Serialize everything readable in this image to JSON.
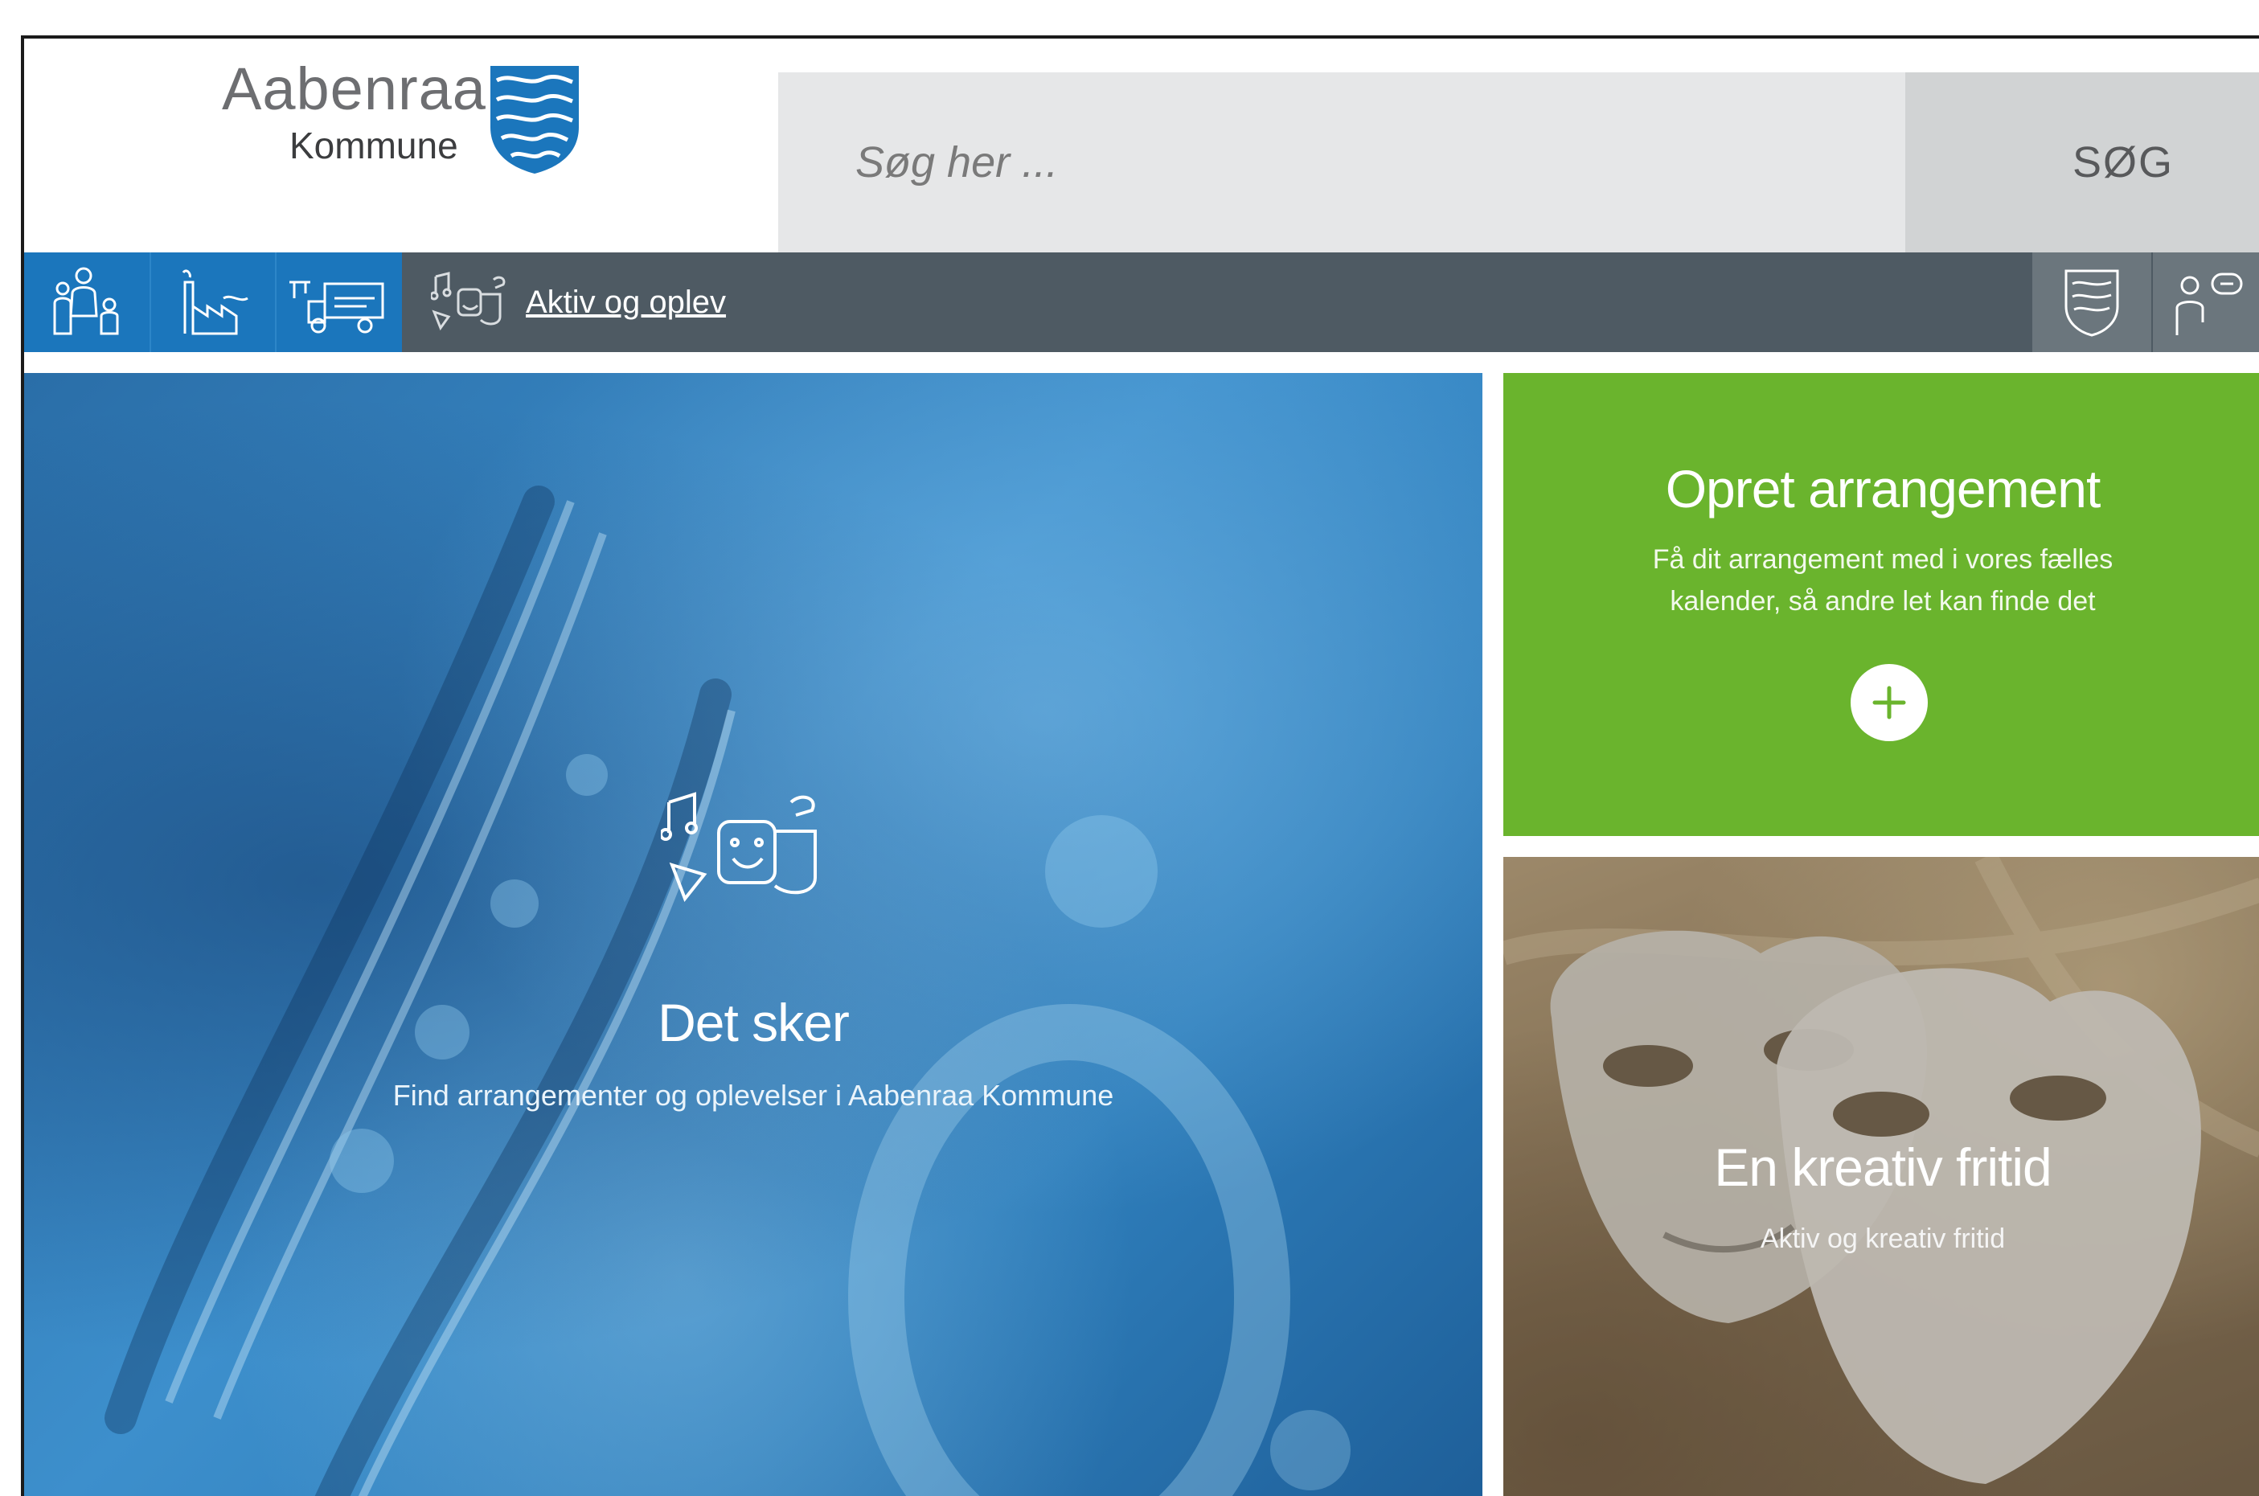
{
  "header": {
    "logo_line1": "Aabenraa",
    "logo_line2": "Kommune"
  },
  "search": {
    "placeholder": "Søg her ...",
    "button_label": "SØG"
  },
  "nav": {
    "items": [
      {
        "icon": "family-icon"
      },
      {
        "icon": "factory-icon"
      },
      {
        "icon": "tools-truck-icon"
      },
      {
        "icon": "culture-masks-icon",
        "label": "Aktiv og oplev",
        "active": true
      }
    ],
    "right_items": [
      {
        "icon": "municipality-shield-icon"
      },
      {
        "icon": "person-chat-icon"
      }
    ]
  },
  "tiles": {
    "hero": {
      "title": "Det sker",
      "subtitle": "Find arrangementer og oplevelser i Aabenraa Kommune"
    },
    "create": {
      "title": "Opret arrangement",
      "description": "Få dit arrangement med i vores fælles kalender, så andre let kan finde det"
    },
    "creative": {
      "title": "En kreativ fritid",
      "subtitle": "Aktiv og kreativ fritid"
    }
  },
  "colors": {
    "nav_bg": "#4e5a63",
    "nav_tile_blue": "#1b76bc",
    "create_green": "#6ab42d",
    "search_bg": "#e6e7e8",
    "search_button_bg": "#d1d3d4"
  }
}
